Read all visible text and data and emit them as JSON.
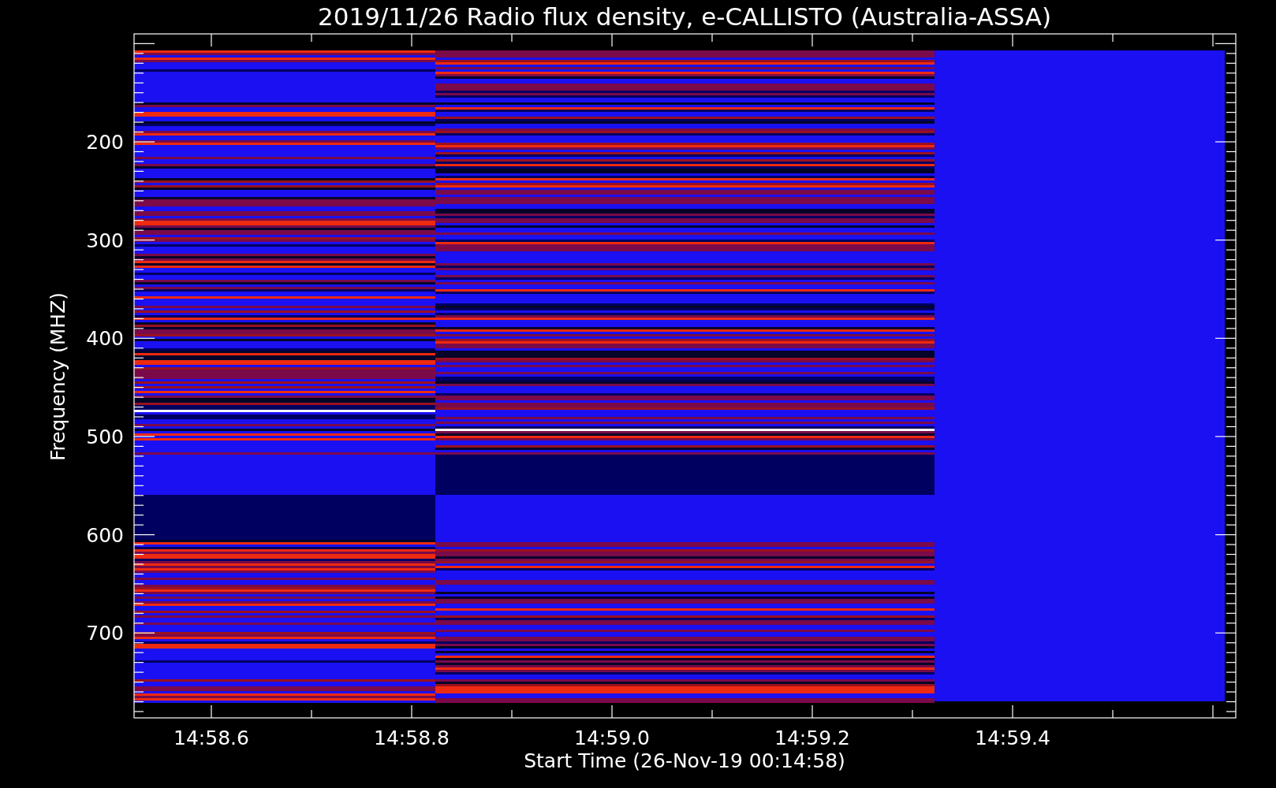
{
  "title": "2019/11/26  Radio flux density, e-CALLISTO (Australia-ASSA)",
  "spectrogram": {
    "ylabel": "Frequency (MHZ)",
    "xlabel": "Start Time (26-Nov-19 00:14:58)",
    "y_tick_labels": [
      "200",
      "300",
      "400",
      "500",
      "600",
      "700"
    ],
    "x_tick_labels": [
      "14:58.6",
      "14:58.8",
      "14:59.0",
      "14:59.2",
      "14:59.4"
    ]
  }
}
